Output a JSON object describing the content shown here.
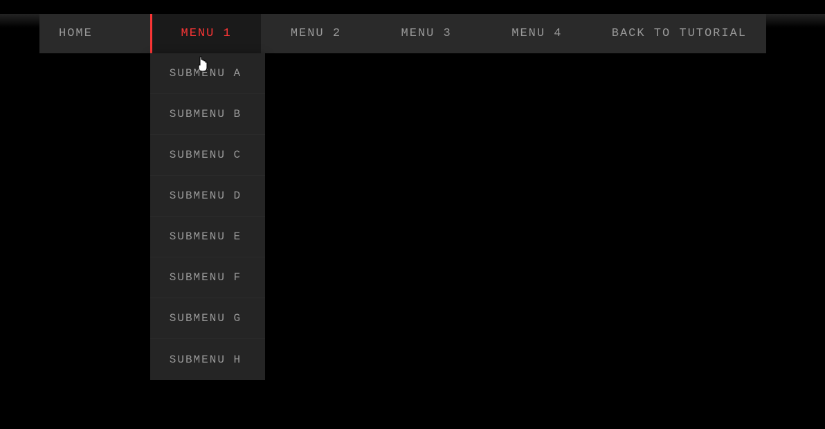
{
  "nav": {
    "home": "HOME",
    "menu1": "MENU 1",
    "menu2": "MENU 2",
    "menu3": "MENU 3",
    "menu4": "MENU 4",
    "back": "BACK TO TUTORIAL"
  },
  "dropdown": {
    "items": [
      "SUBMENU A",
      "SUBMENU B",
      "SUBMENU C",
      "SUBMENU D",
      "SUBMENU E",
      "SUBMENU F",
      "SUBMENU G",
      "SUBMENU H"
    ]
  },
  "colors": {
    "accent": "#fa3535",
    "navBg": "#2a2a2a",
    "activeBg": "#1a1a1a",
    "text": "#999"
  }
}
